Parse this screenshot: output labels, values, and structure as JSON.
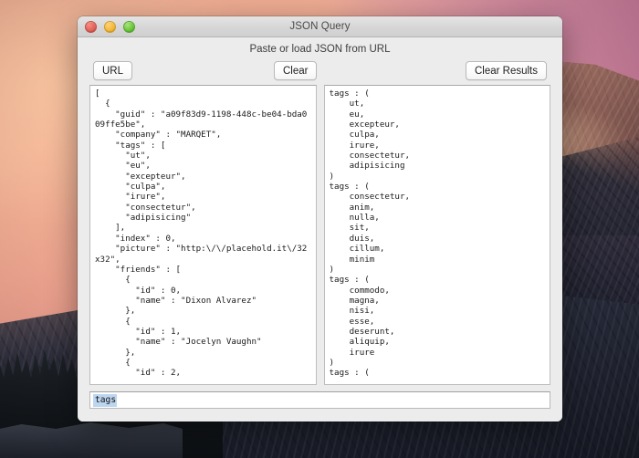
{
  "desktop": {
    "wallpaper_name": "yosemite-el-capitan-sunset",
    "colors": {
      "sky_top": "#e9a58e",
      "sky_right": "#c67b96",
      "granite_dark": "#262a38",
      "tree_silhouette": "#13171b"
    }
  },
  "window": {
    "title": "JSON Query",
    "subtitle": "Paste or load JSON from URL",
    "traffic_lights": [
      {
        "name": "close",
        "color": "#e2685d"
      },
      {
        "name": "minimize",
        "color": "#f5bb3e"
      },
      {
        "name": "zoom",
        "color": "#6fc93f"
      }
    ],
    "toolbar": {
      "url_label": "URL",
      "clear_label": "Clear",
      "clear_results_label": "Clear Results"
    },
    "json_input": {
      "text": "[\n  {\n    \"guid\" : \"a09f83d9-1198-448c-be04-bda009ffe5be\",\n    \"company\" : \"MARQET\",\n    \"tags\" : [\n      \"ut\",\n      \"eu\",\n      \"excepteur\",\n      \"culpa\",\n      \"irure\",\n      \"consectetur\",\n      \"adipisicing\"\n    ],\n    \"index\" : 0,\n    \"picture\" : \"http:\\/\\/placehold.it\\/32x32\",\n    \"friends\" : [\n      {\n        \"id\" : 0,\n        \"name\" : \"Dixon Alvarez\"\n      },\n      {\n        \"id\" : 1,\n        \"name\" : \"Jocelyn Vaughn\"\n      },\n      {\n        \"id\" : 2,"
    },
    "results": {
      "text": "tags : (\n    ut,\n    eu,\n    excepteur,\n    culpa,\n    irure,\n    consectetur,\n    adipisicing\n)\ntags : (\n    consectetur,\n    anim,\n    nulla,\n    sit,\n    duis,\n    cillum,\n    minim\n)\ntags : (\n    commodo,\n    magna,\n    nisi,\n    esse,\n    deserunt,\n    aliquip,\n    irure\n)\ntags : ("
    },
    "query_field": {
      "value": "tags",
      "placeholder": "",
      "selection_color": "#bcd6f0"
    }
  }
}
